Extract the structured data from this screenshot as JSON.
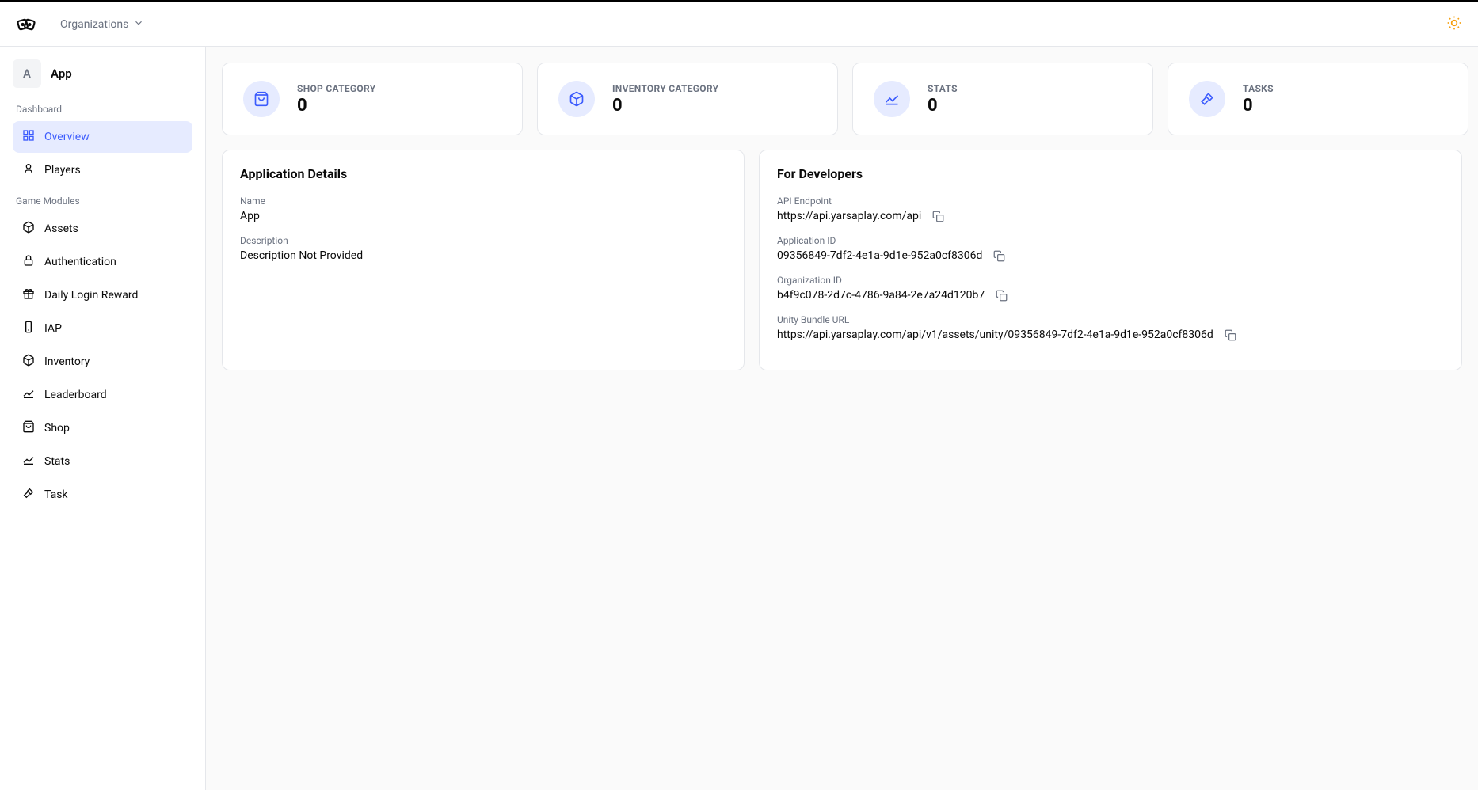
{
  "header": {
    "org_label": "Organizations"
  },
  "sidebar": {
    "app_initial": "A",
    "app_name": "App",
    "section_dashboard": "Dashboard",
    "section_modules": "Game Modules",
    "items": {
      "overview": "Overview",
      "players": "Players",
      "assets": "Assets",
      "authentication": "Authentication",
      "daily_login": "Daily Login Reward",
      "iap": "IAP",
      "inventory": "Inventory",
      "leaderboard": "Leaderboard",
      "shop": "Shop",
      "stats": "Stats",
      "task": "Task"
    }
  },
  "stats": [
    {
      "label": "SHOP CATEGORY",
      "value": "0"
    },
    {
      "label": "INVENTORY CATEGORY",
      "value": "0"
    },
    {
      "label": "STATS",
      "value": "0"
    },
    {
      "label": "TASKS",
      "value": "0"
    }
  ],
  "details": {
    "title": "Application Details",
    "name_label": "Name",
    "name_value": "App",
    "desc_label": "Description",
    "desc_value": "Description Not Provided"
  },
  "dev": {
    "title": "For Developers",
    "api_label": "API Endpoint",
    "api_value": "https://api.yarsaplay.com/api",
    "appid_label": "Application ID",
    "appid_value": "09356849-7df2-4e1a-9d1e-952a0cf8306d",
    "orgid_label": "Organization ID",
    "orgid_value": "b4f9c078-2d7c-4786-9a84-2e7a24d120b7",
    "unity_label": "Unity Bundle URL",
    "unity_value": "https://api.yarsaplay.com/api/v1/assets/unity/09356849-7df2-4e1a-9d1e-952a0cf8306d"
  }
}
